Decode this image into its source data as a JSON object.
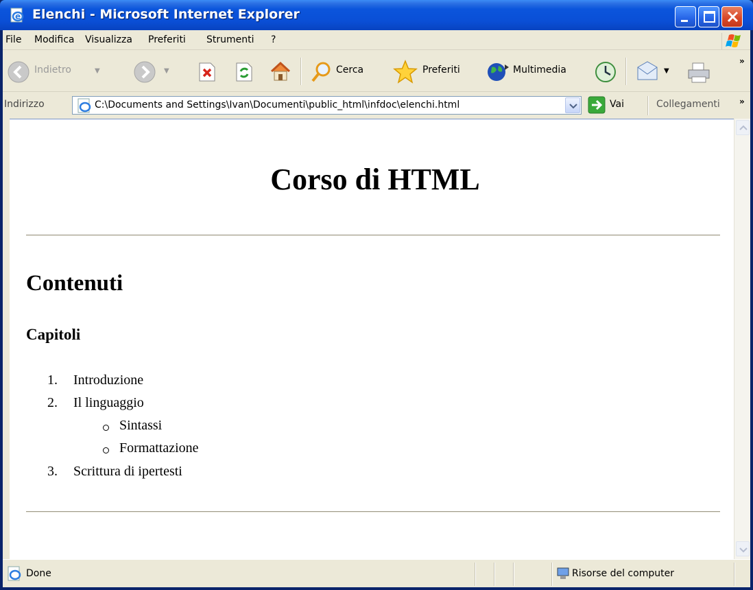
{
  "window": {
    "title": "Elenchi - Microsoft Internet Explorer"
  },
  "menu": [
    "File",
    "Modifica",
    "Visualizza",
    "Preferiti",
    "Strumenti",
    "?"
  ],
  "toolbar": {
    "back_label": "Indietro",
    "search_label": "Cerca",
    "favorites_label": "Preferiti",
    "media_label": "Multimedia"
  },
  "address": {
    "label": "Indirizzo",
    "url": "C:\\Documents and Settings\\Ivan\\Documenti\\public_html\\infdoc\\elenchi.html",
    "go_label": "Vai",
    "links_label": "Collegamenti"
  },
  "page": {
    "h1": "Corso di HTML",
    "h2": "Contenuti",
    "h3": "Capitoli",
    "list": [
      {
        "num": "1.",
        "text": "Introduzione"
      },
      {
        "num": "2.",
        "text": "Il linguaggio",
        "children": [
          "Sintassi",
          "Formattazione"
        ]
      },
      {
        "num": "3.",
        "text": "Scrittura di ipertesti"
      }
    ]
  },
  "status": {
    "text": "Done",
    "zone": "Risorse del computer"
  }
}
